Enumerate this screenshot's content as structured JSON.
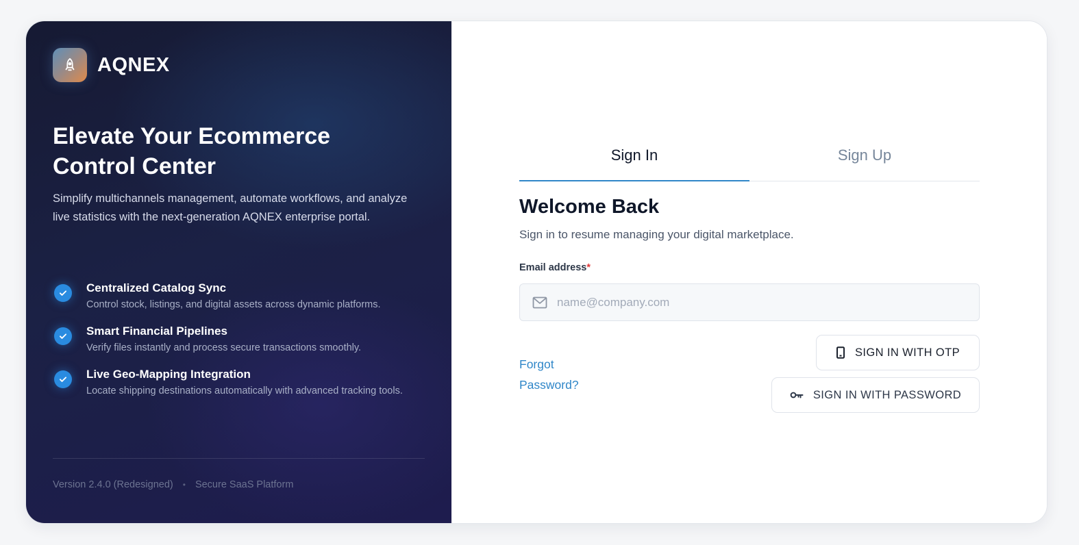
{
  "brand": {
    "name": "AQNEX"
  },
  "hero": {
    "headline": "Elevate Your Ecommerce Control Center",
    "lead": "Simplify multichannels management, automate workflows, and analyze live statistics with the next-generation AQNEX enterprise portal."
  },
  "features": [
    {
      "title": "Centralized Catalog Sync",
      "desc": "Control stock, listings, and digital assets across dynamic platforms."
    },
    {
      "title": "Smart Financial Pipelines",
      "desc": "Verify files instantly and process secure transactions smoothly."
    },
    {
      "title": "Live Geo-Mapping Integration",
      "desc": "Locate shipping destinations automatically with advanced tracking tools."
    }
  ],
  "footer": {
    "version": "Version 2.4.0 (Redesigned)",
    "separator": "•",
    "platform": "Secure SaaS Platform"
  },
  "tabs": {
    "signin": "Sign In",
    "signup": "Sign Up",
    "active": "signin"
  },
  "form": {
    "title": "Welcome Back",
    "subtitle": "Sign in to resume managing your digital marketplace.",
    "email_label": "Email address",
    "required_mark": "*",
    "email_placeholder": "name@company.com",
    "email_value": "",
    "forgot_label": "Forgot Password?",
    "otp_button": "SIGN IN WITH OTP",
    "password_button": "SIGN IN WITH PASSWORD"
  },
  "icons": {
    "logo": "rocket-icon",
    "feature_check": "check-circle-icon",
    "email": "mail-icon",
    "otp": "phone-icon",
    "password": "key-icon"
  },
  "colors": {
    "accent": "#2f86c8",
    "check": "#2a8be0",
    "panel_dark": "#1b2145",
    "required": "#e03a3a"
  }
}
